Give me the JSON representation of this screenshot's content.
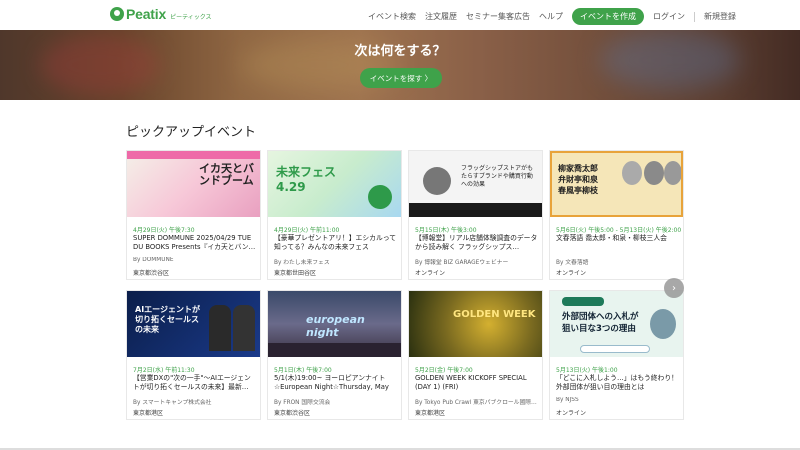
{
  "header": {
    "logo_text": "Peatix",
    "logo_sub": "ピーティックス",
    "nav": {
      "search": "イベント検索",
      "orders": "注文履歴",
      "seminar_ad": "セミナー集客広告",
      "help": "ヘルプ",
      "create": "イベントを作成",
      "login": "ログイン",
      "signup": "新規登録"
    }
  },
  "hero": {
    "title": "次は何をする？",
    "button": "イベントを探す 〉"
  },
  "section": {
    "title": "ピックアップイベント"
  },
  "cards": [
    {
      "thumb_text": "イカ天とバンドブーム",
      "date": "4月29日(火) 午後7:30",
      "title": "SUPER DOMMUNE 2025/04/29 TUE DU BOOKS Presents『イカ天とバン…",
      "org": "By DOMMUNE",
      "loc": "東京都渋谷区"
    },
    {
      "thumb_text": "未来フェス 4.29",
      "date": "4月29日(火) 午前11:00",
      "title": "【豪華プレゼントアリ！】エシカルって知ってる？みんなの未来フェス",
      "org": "By わたし未来フェス",
      "loc": "東京都世田谷区"
    },
    {
      "thumb_text": "フラッグシップストアがもたらすブランドや購買行動への効果",
      "date": "5月15日(木) 午後3:00",
      "title": "【博報堂】リアル店舗体験調査のデータから読み解く フラッグシップス…",
      "org": "By 博報堂 BIZ GARAGEウェビナー",
      "loc": "オンライン"
    },
    {
      "thumb_text": "柳家喬太郎 弁財亭和泉 春風亭柳枝",
      "date": "5月6日(火) 午後5:00 - 5月13日(火) 午後2:00",
      "title": "文春落語 喬太郎・和泉・柳枝三人会",
      "org": "By 文春落語",
      "loc": "オンライン"
    },
    {
      "thumb_text": "AIエージェントが切り拓くセールスの未来",
      "date": "7月2日(水) 午前11:30",
      "title": "【営業DXの\"次の一手\"〜AIエージェントが切り拓くセールスの未来】最新…",
      "org": "By スマートキャンプ株式会社",
      "loc": "東京都港区"
    },
    {
      "thumb_text": "european night",
      "date": "5月1日(木) 午後7:00",
      "title": "5/1(木)19:00~ ヨーロピアンナイト☆European Night☆Thursday, May 1st♪",
      "org": "By FRON 国際交流会",
      "loc": "東京都渋谷区"
    },
    {
      "thumb_text": "GOLDEN WEEK",
      "date": "5月2日(金) 午後7:00",
      "title": "GOLDEN WEEK KICKOFF SPECIAL (DAY 1) (FRI)",
      "org": "By Tokyo Pub Crawl 東京パブクロール國際…",
      "loc": "東京都港区"
    },
    {
      "thumb_text": "外部団体への入札が狙い目な3つの理由",
      "date": "5月13日(火) 午後1:00",
      "title": "「どこに入札しよう…」はもう終わり！外部団体が狙い目の理由とは",
      "org": "By NJSS",
      "loc": "オンライン"
    }
  ],
  "carousel": {
    "next": "›"
  }
}
